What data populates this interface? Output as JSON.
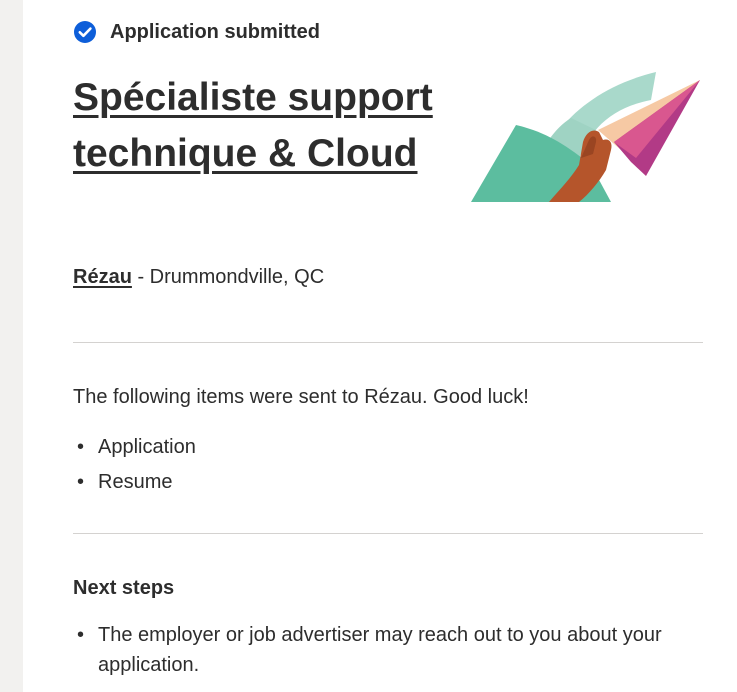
{
  "status": {
    "icon": "check-circle-icon",
    "text": "Application submitted",
    "icon_color": "#0d5ed9"
  },
  "job": {
    "title": "Spécialiste support technique & Cloud",
    "company": "Rézau",
    "location_suffix": " - Drummondville, QC"
  },
  "illustration": {
    "icon": "paper-airplane-hand-illustration"
  },
  "sent": {
    "message": "The following items were sent to Rézau. Good luck!",
    "items": [
      "Application",
      "Resume"
    ]
  },
  "next_steps": {
    "heading": "Next steps",
    "items": [
      "The employer or job advertiser may reach out to you about your application."
    ]
  },
  "colors": {
    "text": "#2d2d2d",
    "divider": "#d4d2d0",
    "rail": "#f2f1ef"
  }
}
